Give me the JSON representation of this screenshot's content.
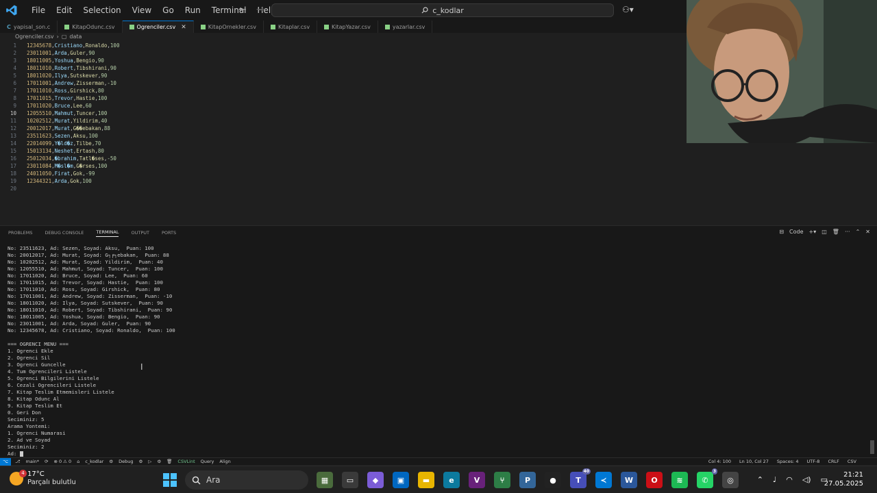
{
  "menu": [
    "File",
    "Edit",
    "Selection",
    "View",
    "Go",
    "Run",
    "Terminal",
    "Help"
  ],
  "nav": {
    "back": "←",
    "forward": "→"
  },
  "search": {
    "text": "c_kodlar"
  },
  "tabs": [
    {
      "label": "yapisal_son.c",
      "icon": "c",
      "active": false
    },
    {
      "label": "KitapOdunc.csv",
      "icon": "csv",
      "active": false
    },
    {
      "label": "Ogrenciler.csv",
      "icon": "csv",
      "active": true
    },
    {
      "label": "KitapOrnekler.csv",
      "icon": "csv",
      "active": false
    },
    {
      "label": "Kitaplar.csv",
      "icon": "csv",
      "active": false
    },
    {
      "label": "KitapYazar.csv",
      "icon": "csv",
      "active": false
    },
    {
      "label": "yazarlar.csv",
      "icon": "csv",
      "active": false
    }
  ],
  "breadcrumb": {
    "file": "Ogrenciler.csv",
    "node": "data"
  },
  "editor": {
    "current_line": 10,
    "lines": [
      {
        "n": "1",
        "no": "12345678",
        "name": "Cristiano",
        "surname": "Ronaldo",
        "score": "100"
      },
      {
        "n": "2",
        "no": "23011001",
        "name": "Arda",
        "surname": "Guler",
        "score": "90"
      },
      {
        "n": "3",
        "no": "18011005",
        "name": "Yoshua",
        "surname": "Bengio",
        "score": "90"
      },
      {
        "n": "4",
        "no": "18011010",
        "name": "Robert",
        "surname": "Tibshirani",
        "score": "90"
      },
      {
        "n": "5",
        "no": "18011020",
        "name": "Ilya",
        "surname": "Sutskever",
        "score": "90"
      },
      {
        "n": "6",
        "no": "17011001",
        "name": "Andrew",
        "surname": "Zisserman",
        "score": "-10"
      },
      {
        "n": "7",
        "no": "17011010",
        "name": "Ross",
        "surname": "Girshick",
        "score": "80"
      },
      {
        "n": "8",
        "no": "17011015",
        "name": "Trevor",
        "surname": "Hastie",
        "score": "100"
      },
      {
        "n": "9",
        "no": "17011020",
        "name": "Bruce",
        "surname": "Lee",
        "score": "60"
      },
      {
        "n": "10",
        "no": "12055510",
        "name": "Mahmut",
        "surname": "Tuncer",
        "score": "100"
      },
      {
        "n": "11",
        "no": "10202512",
        "name": "Murat",
        "surname": "Yildirim",
        "score": "40"
      },
      {
        "n": "12",
        "no": "20012017",
        "name": "Murat",
        "surname": "G��ebakan",
        "score": "88"
      },
      {
        "n": "13",
        "no": "23511623",
        "name": "Sezen",
        "surname": "Aksu",
        "score": "100"
      },
      {
        "n": "14",
        "no": "22014099",
        "name": "Y�ld�z",
        "surname": "Tilbe",
        "score": "70"
      },
      {
        "n": "15",
        "no": "15013134",
        "name": "Neshet",
        "surname": "Ertash",
        "score": "80"
      },
      {
        "n": "16",
        "no": "25012034",
        "name": "�brahim",
        "surname": "Tatl�ses",
        "score": "-50"
      },
      {
        "n": "17",
        "no": "23011084",
        "name": "M�sl�m",
        "surname": "G�rses",
        "score": "100"
      },
      {
        "n": "18",
        "no": "24011050",
        "name": "Firat",
        "surname": "Gok",
        "score": "-99"
      },
      {
        "n": "19",
        "no": "12344321",
        "name": "Arda",
        "surname": "Gok",
        "score": "100"
      },
      {
        "n": "20",
        "no": "",
        "name": "",
        "surname": "",
        "score": ""
      }
    ]
  },
  "panel": {
    "tabs": [
      "PROBLEMS",
      "DEBUG CONSOLE",
      "TERMINAL",
      "OUTPUT",
      "PORTS"
    ],
    "active_tab": "TERMINAL",
    "shell_label": "Code",
    "terminal_lines": [
      "No: 23511623, Ad: Sezen, Soyad: Aksu,  Puan: 100",
      "No: 20012017, Ad: Murat, Soyad: G┐╒┐ebakan,  Puan: 88",
      "No: 10202512, Ad: Murat, Soyad: Yildirim,  Puan: 40",
      "No: 12055510, Ad: Mahmut, Soyad: Tuncer,  Puan: 100",
      "No: 17011020, Ad: Bruce, Soyad: Lee,  Puan: 60",
      "No: 17011015, Ad: Trevor, Soyad: Hastie,  Puan: 100",
      "No: 17011010, Ad: Ross, Soyad: Girshick,  Puan: 80",
      "No: 17011001, Ad: Andrew, Soyad: Zisserman,  Puan: -10",
      "No: 18011020, Ad: Ilya, Soyad: Sutskever,  Puan: 90",
      "No: 18011010, Ad: Robert, Soyad: Tibshirani,  Puan: 90",
      "No: 18011005, Ad: Yoshua, Soyad: Bengio,  Puan: 90",
      "No: 23011001, Ad: Arda, Soyad: Guler,  Puan: 90",
      "No: 12345678, Ad: Cristiano, Soyad: Ronaldo,  Puan: 100",
      "",
      "=== OGRENCI MENU ===",
      "1. Ogrenci Ekle",
      "2. Ogrenci Sil",
      "3. Ogrenci Guncelle",
      "4. Tum Ogrencileri Listele",
      "5. Ogrenci Bilgilerini Listele",
      "6. Cezali Ogrencileri Listele",
      "7. Kitap Teslim Etmemisleri Listele",
      "8. Kitap Odunc Al",
      "9. Kitap Teslim Et",
      "0. Geri Don",
      "Seciminiz: 5",
      "Arama Yontemi:",
      "1. Ogrenci Numarasi",
      "2. Ad ve Soyad",
      "Seciminiz: 2",
      "Ad: "
    ]
  },
  "statusbar": {
    "left": [
      "main*",
      "⊗ 0 ⚠ 0",
      "c_kodlar",
      "Debug"
    ],
    "csvlint": "CSVLint",
    "query": "Query",
    "align": "Align",
    "right": [
      "Col 4: 100",
      "Ln 10, Col 27",
      "Spaces: 4",
      "UTF-8",
      "CRLF",
      "CSV"
    ]
  },
  "taskbar": {
    "weather_temp": "17°C",
    "weather_desc": "Parçalı bulutlu",
    "weather_badge": "4",
    "search_placeholder": "Ara",
    "time": "21:21",
    "date": "27.05.2025",
    "teams_badge": "40",
    "whatsapp_badge": "3"
  },
  "colors": {
    "accent": "#0078d4",
    "csv_icon": "#89d185"
  }
}
